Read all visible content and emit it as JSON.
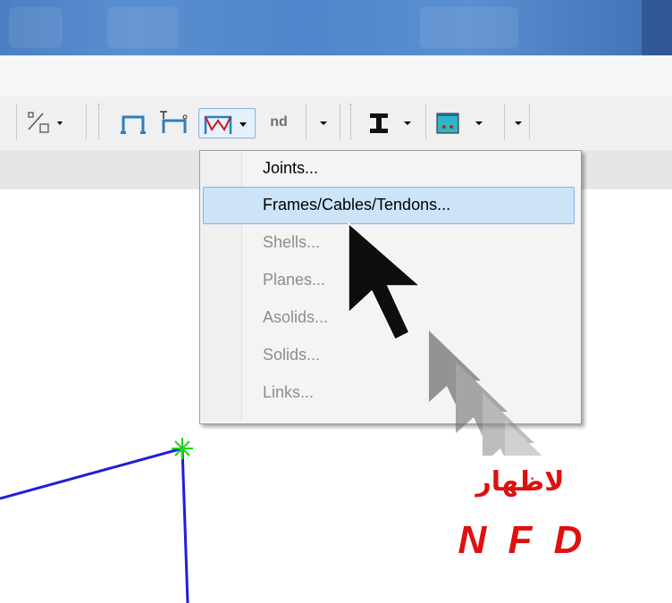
{
  "toolbar": {
    "nd_label": "nd"
  },
  "context_menu": {
    "items": [
      {
        "label": "Joints...",
        "enabled": true
      },
      {
        "label": "Frames/Cables/Tendons...",
        "enabled": true,
        "highlighted": true
      },
      {
        "label": "Shells...",
        "enabled": false
      },
      {
        "label": "Planes...",
        "enabled": false
      },
      {
        "label": "Asolids...",
        "enabled": false
      },
      {
        "label": "Solids...",
        "enabled": false
      },
      {
        "label": "Links...",
        "enabled": false
      }
    ]
  },
  "annotation": {
    "arabic_text": "لاظهار",
    "nfd_text": "N F D",
    "color": "#e01010"
  },
  "model": {
    "frame_color": "#1f1fd6",
    "joint_color": "#1bd41b"
  }
}
